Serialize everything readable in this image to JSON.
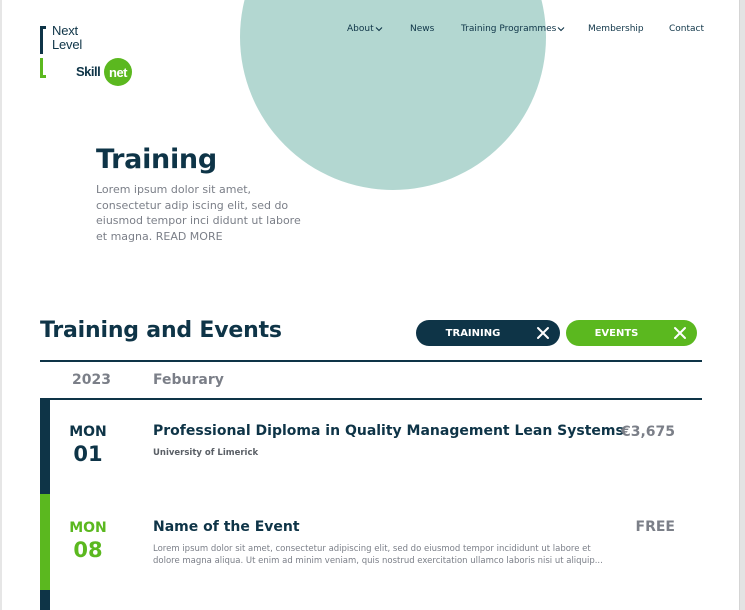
{
  "brand": {
    "logo_line1": "Next",
    "logo_line2": "Level",
    "logo_skill": "Skill",
    "logo_net": "net",
    "dark_color": "#0e3447",
    "accent_color": "#5bb81f",
    "circle_color": "#b3d7d1"
  },
  "nav": {
    "items": [
      {
        "label": "About",
        "has_dropdown": true
      },
      {
        "label": "News",
        "has_dropdown": false
      },
      {
        "label": "Training Programmes",
        "has_dropdown": true
      },
      {
        "label": "Membership",
        "has_dropdown": false
      },
      {
        "label": "Contact",
        "has_dropdown": false
      }
    ]
  },
  "hero": {
    "title": "Training",
    "body": "Lorem ipsum dolor sit amet, consectetur adip iscing elit, sed do eiusmod tempor inci didunt ut labore et magna. READ MORE"
  },
  "events_section": {
    "title": "Training and Events",
    "filters": [
      {
        "label": "TRAINING",
        "icon": "close-icon"
      },
      {
        "label": "EVENTS",
        "icon": "close-icon"
      }
    ],
    "year": "2023",
    "month": "Feburary",
    "events": [
      {
        "day": "MON",
        "date": "01",
        "title": "Professional Diploma in Quality Management Lean Systems",
        "subtitle": "University of Limerick",
        "price": "€3,675",
        "category": "training"
      },
      {
        "day": "MON",
        "date": "08",
        "title": "Name of the Event",
        "description": "Lorem ipsum dolor sit amet, consectetur adipiscing elit, sed do eiusmod tempor incididunt ut labore et dolore magna aliqua. Ut enim ad minim veniam, quis nostrud exercitation ullamco laboris nisi ut aliquip...",
        "price": "FREE",
        "category": "event"
      }
    ]
  }
}
